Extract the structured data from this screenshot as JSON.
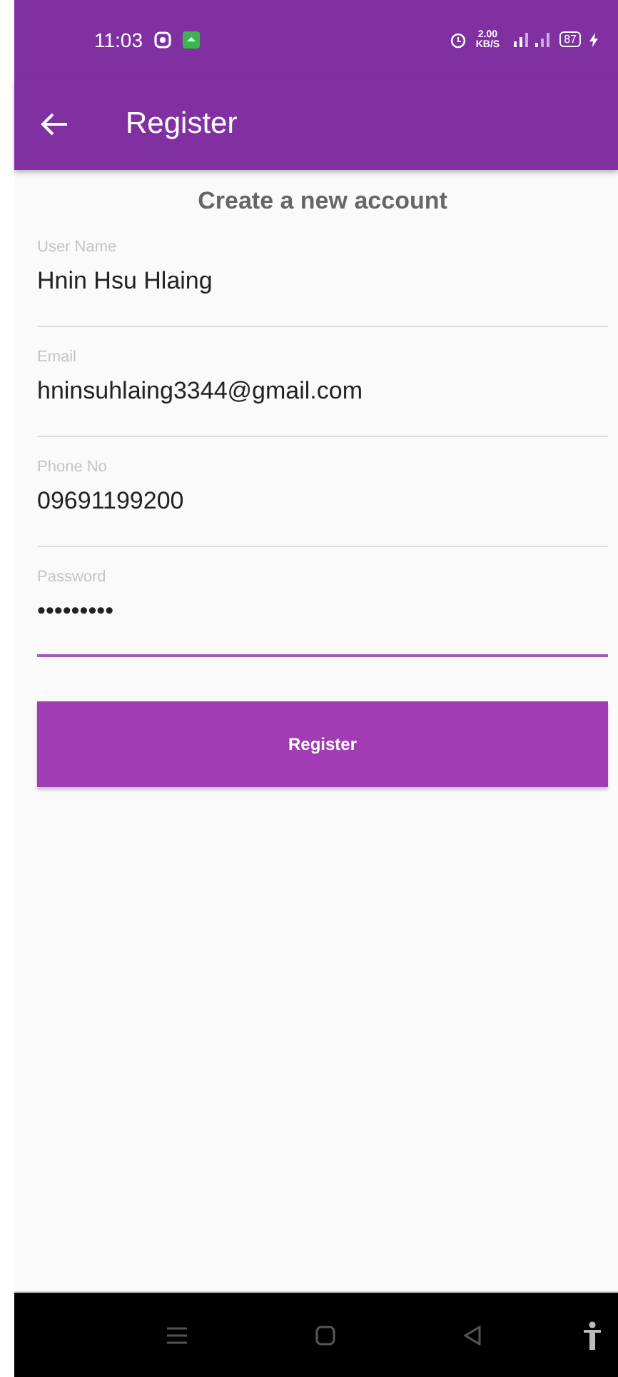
{
  "status_bar": {
    "time": "11:03",
    "speed_value": "2.00",
    "speed_unit": "KB/S",
    "battery": "87"
  },
  "app_bar": {
    "title": "Register"
  },
  "heading": "Create a new account",
  "fields": [
    {
      "label": "User Name",
      "value": "Hnin Hsu Hlaing",
      "focused": false
    },
    {
      "label": "Email",
      "value": "hninsuhlaing3344@gmail.com",
      "focused": false
    },
    {
      "label": "Phone No",
      "value": "09691199200",
      "focused": false
    },
    {
      "label": "Password",
      "value": "•••••••••",
      "focused": true
    }
  ],
  "button": "Register"
}
